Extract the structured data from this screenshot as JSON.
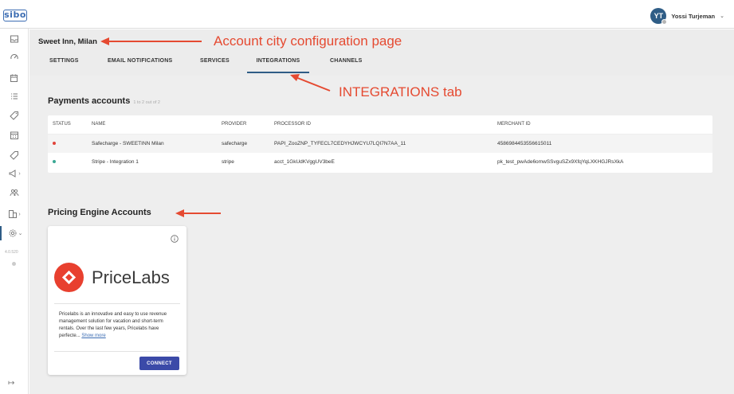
{
  "app": {
    "logo_text": "sibo",
    "version": "4.0.520"
  },
  "user": {
    "initials": "YT",
    "name": "Yossi Turjeman"
  },
  "page": {
    "title": "Sweet Inn, Milan"
  },
  "tabs": [
    {
      "label": "SETTINGS",
      "active": false
    },
    {
      "label": "EMAIL NOTIFICATIONS",
      "active": false
    },
    {
      "label": "SERVICES",
      "active": false
    },
    {
      "label": "INTEGRATIONS",
      "active": true
    },
    {
      "label": "CHANNELS",
      "active": false
    }
  ],
  "payments": {
    "title": "Payments accounts",
    "count": "1 to 2 out of 2",
    "columns": [
      "STATUS",
      "NAME",
      "PROVIDER",
      "PROCESSOR ID",
      "MERCHANT ID"
    ],
    "rows": [
      {
        "status_color": "#e0443a",
        "name": "Safecharge - SWEETINN Milan",
        "provider": "safecharge",
        "processor_id": "PAPI_ZooZNP_TYFECL7CEDYHJWCYU7LQI7N7AA_11",
        "merchant_id": "4586984453556615011"
      },
      {
        "status_color": "#3aa894",
        "name": "Stripe - Integration 1",
        "provider": "stripe",
        "processor_id": "acct_1GkUdKVggUV3beE",
        "merchant_id": "pk_test_pwAde6omwSSvguSZx9XfqYqLXKHGJRsXkA"
      }
    ]
  },
  "pricing": {
    "title": "Pricing Engine Accounts",
    "card": {
      "brand": "PriceLabs",
      "description": "Pricelabs is an innovative and easy to use revenue management solution for vacation and short-term rentals. Over the last few years, Pricelabs have perfecte...",
      "show_more": "Show more",
      "connect_label": "CONNECT"
    }
  },
  "annotations": {
    "city_page": "Account city configuration page",
    "integrations_tab": "INTEGRATIONS tab"
  },
  "colors": {
    "primary": "#2f5d86",
    "connect": "#3b4aa8",
    "brand_red": "#e8402f",
    "annotation": "#e54a31"
  }
}
